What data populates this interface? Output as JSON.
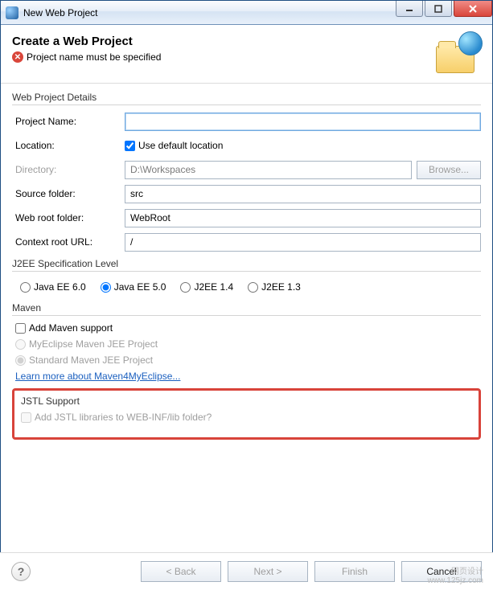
{
  "window": {
    "title": "New Web Project"
  },
  "banner": {
    "heading": "Create a Web Project",
    "error": "Project name must be specified"
  },
  "groups": {
    "details": {
      "title": "Web Project Details",
      "project_name_label": "Project Name:",
      "project_name_value": "",
      "location_label": "Location:",
      "use_default_label": "Use default location",
      "use_default_checked": true,
      "directory_label": "Directory:",
      "directory_value": "D:\\Workspaces",
      "browse_label": "Browse...",
      "source_folder_label": "Source folder:",
      "source_folder_value": "src",
      "web_root_label": "Web root folder:",
      "web_root_value": "WebRoot",
      "context_root_label": "Context root URL:",
      "context_root_value": "/"
    },
    "j2ee": {
      "title": "J2EE Specification Level",
      "options": [
        "Java EE 6.0",
        "Java EE 5.0",
        "J2EE 1.4",
        "J2EE 1.3"
      ],
      "selected_index": 1
    },
    "maven": {
      "title": "Maven",
      "add_support_label": "Add Maven support",
      "add_support_checked": false,
      "option_myeclipse": "MyEclipse Maven JEE Project",
      "option_standard": "Standard Maven JEE Project",
      "selected": "standard",
      "link_label": "Learn more about Maven4MyEclipse..."
    },
    "jstl": {
      "title": "JSTL Support",
      "add_label": "Add JSTL libraries to WEB-INF/lib folder?",
      "add_checked": false
    }
  },
  "footer": {
    "back": "< Back",
    "next": "Next >",
    "finish": "Finish",
    "cancel": "Cancel"
  }
}
